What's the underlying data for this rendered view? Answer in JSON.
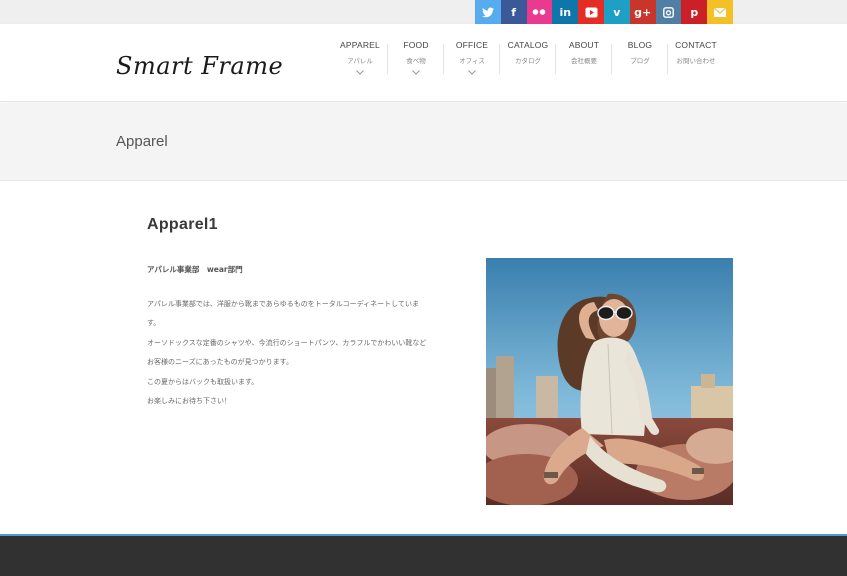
{
  "social": [
    {
      "name": "twitter",
      "icon": "twitter-icon",
      "color": "#55acee"
    },
    {
      "name": "facebook",
      "icon": "facebook-icon",
      "color": "#3b5998",
      "glyph": "f"
    },
    {
      "name": "flickr",
      "icon": "flickr-icon",
      "color": "#ea3a8f"
    },
    {
      "name": "linkedin",
      "icon": "linkedin-icon",
      "color": "#0e76a8",
      "glyph": "in"
    },
    {
      "name": "youtube",
      "icon": "youtube-icon",
      "color": "#e52d27"
    },
    {
      "name": "vimeo",
      "icon": "vimeo-icon",
      "color": "#1e9fc4",
      "glyph": "v"
    },
    {
      "name": "google-plus",
      "icon": "google-plus-icon",
      "color": "#c9352a",
      "glyph": "g+"
    },
    {
      "name": "instagram",
      "icon": "instagram-icon",
      "color": "#517fa4"
    },
    {
      "name": "pinterest",
      "icon": "pinterest-icon",
      "color": "#cb2027",
      "glyph": "p"
    },
    {
      "name": "email",
      "icon": "mail-icon",
      "color": "#f3c028"
    }
  ],
  "header": {
    "logo": "Smart Frame",
    "nav": [
      {
        "en": "APPAREL",
        "jp": "アパレル",
        "dropdown": true
      },
      {
        "en": "FOOD",
        "jp": "食べ物",
        "dropdown": true
      },
      {
        "en": "OFFICE",
        "jp": "オフィス",
        "dropdown": true
      },
      {
        "en": "CATALOG",
        "jp": "カタログ",
        "dropdown": false
      },
      {
        "en": "ABOUT",
        "jp": "会社概要",
        "dropdown": false
      },
      {
        "en": "BLOG",
        "jp": "ブログ",
        "dropdown": false
      },
      {
        "en": "CONTACT",
        "jp": "お問い合わせ",
        "dropdown": false
      }
    ]
  },
  "title_band": {
    "title": "Apparel"
  },
  "main": {
    "heading": "Apparel1",
    "subheading": "アパレル事業部　wear部門",
    "paragraphs": [
      "アパレル事業部では、洋服から靴まであらゆるものをトータルコーディネートしていま",
      "す。",
      "オーソドックスな定番のシャツや、今流行のショートパンツ、カラフルでかわいい靴など",
      "お客様のニーズにあったものが見つかります。",
      "この夏からはバックも取扱います。",
      "お楽しみにお待ち下さい！"
    ]
  },
  "colors": {
    "footer": "#313131",
    "footer_accent": "#4f9ad3",
    "title_band": "#f4f4f4"
  }
}
